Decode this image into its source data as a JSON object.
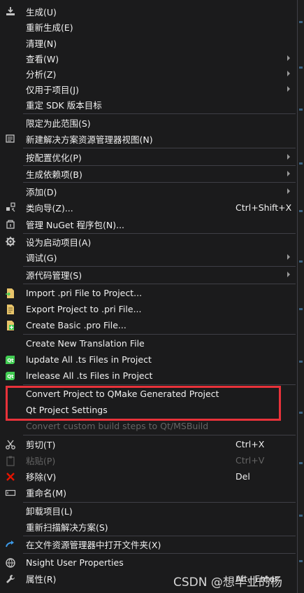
{
  "menu": {
    "items": [
      {
        "label": "生成(U)",
        "icon": "build-icon"
      },
      {
        "label": "重新生成(E)"
      },
      {
        "label": "清理(N)"
      },
      {
        "label": "查看(W)",
        "submenu": true
      },
      {
        "label": "分析(Z)",
        "submenu": true
      },
      {
        "label": "仅用于项目(J)",
        "submenu": true
      },
      {
        "label": "重定 SDK 版本目标"
      },
      {
        "label": "限定为此范围(S)"
      },
      {
        "label": "新建解决方案资源管理器视图(N)",
        "icon": "new-view-icon"
      },
      {
        "label": "按配置优化(P)",
        "submenu": true
      },
      {
        "label": "生成依赖项(B)",
        "submenu": true
      },
      {
        "label": "添加(D)",
        "submenu": true
      },
      {
        "label": "类向导(Z)...",
        "shortcut": "Ctrl+Shift+X",
        "icon": "class-wizard-icon"
      },
      {
        "label": "管理 NuGet 程序包(N)...",
        "icon": "nuget-icon"
      },
      {
        "label": "设为启动项目(A)",
        "icon": "gear-icon"
      },
      {
        "label": "调试(G)",
        "submenu": true
      },
      {
        "label": "源代码管理(S)",
        "submenu": true
      },
      {
        "label": "Import .pri File to Project...",
        "icon": "import-pri-icon"
      },
      {
        "label": "Export Project to .pri File...",
        "icon": "export-pri-icon"
      },
      {
        "label": "Create Basic .pro File...",
        "icon": "create-pro-icon"
      },
      {
        "label": "Create New Translation File"
      },
      {
        "label": "lupdate All .ts Files in Project",
        "icon": "qt-icon"
      },
      {
        "label": "lrelease All .ts Files in Project",
        "icon": "qt-icon"
      },
      {
        "label": "Convert Project to QMake Generated Project"
      },
      {
        "label": "Qt Project Settings"
      },
      {
        "label": "Convert custom build steps to Qt/MSBuild",
        "disabled": true
      },
      {
        "label": "剪切(T)",
        "shortcut": "Ctrl+X",
        "icon": "scissors-icon"
      },
      {
        "label": "粘贴(P)",
        "shortcut": "Ctrl+V",
        "icon": "paste-icon",
        "disabled": true
      },
      {
        "label": "移除(V)",
        "shortcut": "Del",
        "icon": "delete-x-icon"
      },
      {
        "label": "重命名(M)",
        "icon": "rename-icon"
      },
      {
        "label": "卸载项目(L)"
      },
      {
        "label": "重新扫描解决方案(S)"
      },
      {
        "label": "在文件资源管理器中打开文件夹(X)",
        "icon": "open-folder-arrow-icon"
      },
      {
        "label": "Nsight User Properties",
        "icon": "nsight-icon"
      },
      {
        "label": "属性(R)",
        "shortcut": "Alt+Enter",
        "icon": "wrench-icon"
      }
    ]
  },
  "watermark": "CSDN @想毕业的杨",
  "colors": {
    "menu_bg": "#1b1b1c",
    "text": "#f1f1f1",
    "disabled_text": "#656565",
    "separator": "#3f3f46",
    "highlight_border": "#e8323a",
    "qt_green": "#41cd52"
  }
}
